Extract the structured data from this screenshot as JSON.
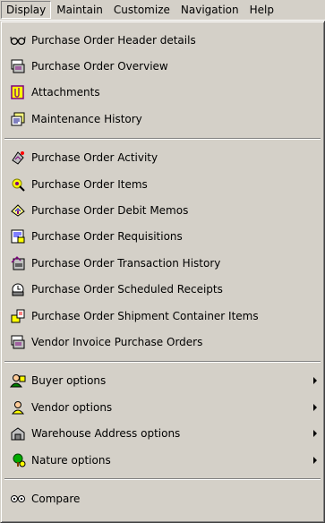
{
  "menubar": {
    "items": [
      "Display",
      "Maintain",
      "Customize",
      "Navigation",
      "Help"
    ]
  },
  "menu": {
    "group1": [
      {
        "label": "Purchase Order Header details",
        "icon": "glasses-icon"
      },
      {
        "label": "Purchase Order Overview",
        "icon": "overview-icon"
      },
      {
        "label": "Attachments",
        "icon": "attachment-icon"
      },
      {
        "label": "Maintenance History",
        "icon": "history-icon"
      }
    ],
    "group2": [
      {
        "label": "Purchase Order Activity",
        "icon": "activity-icon"
      },
      {
        "label": "Purchase Order Items",
        "icon": "items-icon"
      },
      {
        "label": "Purchase Order Debit Memos",
        "icon": "memo-icon"
      },
      {
        "label": "Purchase Order Requisitions",
        "icon": "requisition-icon"
      },
      {
        "label": "Purchase Order Transaction History",
        "icon": "transaction-icon"
      },
      {
        "label": "Purchase Order Scheduled Receipts",
        "icon": "receipt-icon"
      },
      {
        "label": "Purchase Order Shipment Container Items",
        "icon": "shipment-icon"
      },
      {
        "label": "Vendor Invoice Purchase Orders",
        "icon": "invoice-icon"
      }
    ],
    "group3": [
      {
        "label": "Buyer options",
        "icon": "buyer-icon"
      },
      {
        "label": "Vendor options",
        "icon": "vendor-icon"
      },
      {
        "label": "Warehouse Address options",
        "icon": "warehouse-icon"
      },
      {
        "label": "Nature options",
        "icon": "nature-icon"
      }
    ],
    "group4": [
      {
        "label": "Compare",
        "icon": "compare-icon"
      }
    ]
  }
}
